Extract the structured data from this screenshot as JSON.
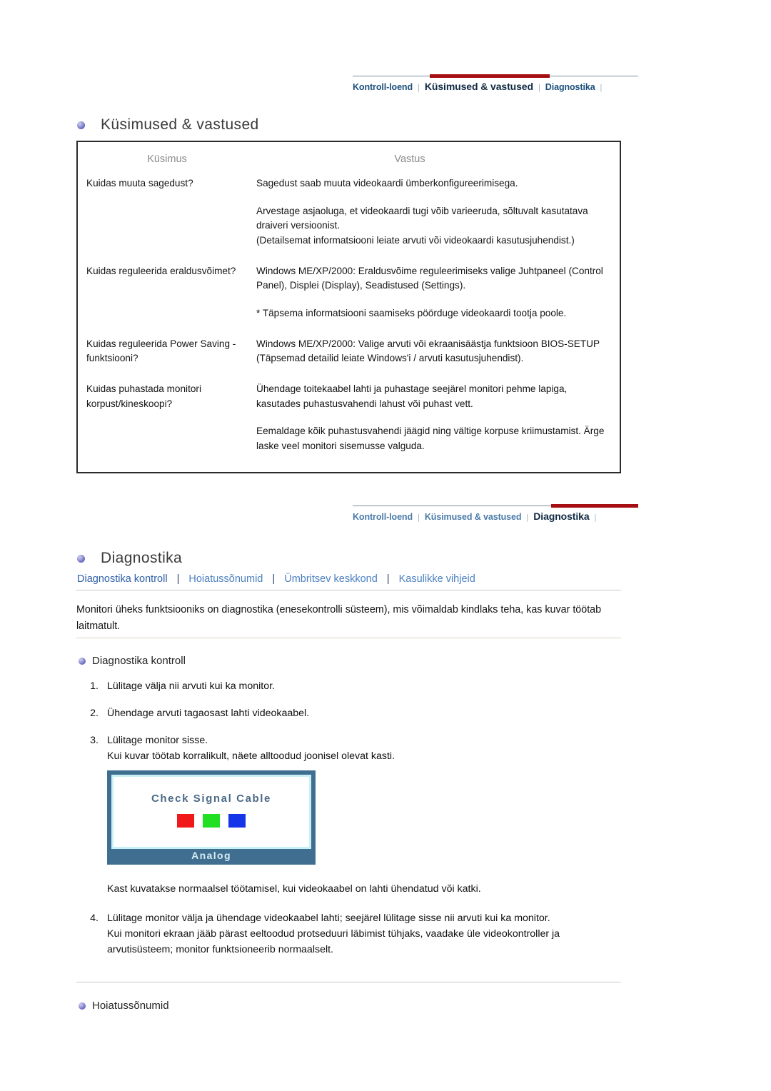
{
  "nav_top": {
    "items": [
      {
        "label": "Kontroll-loend",
        "active": false
      },
      {
        "label": "Küsimused & vastused",
        "active": true
      },
      {
        "label": "Diagnostika",
        "active": false
      }
    ],
    "separator": "|"
  },
  "nav_bottom": {
    "items": [
      {
        "label": "Kontroll-loend",
        "active": false
      },
      {
        "label": "Küsimused & vastused",
        "active": false
      },
      {
        "label": "Diagnostika",
        "active": true
      }
    ],
    "separator": "|"
  },
  "faq": {
    "heading": "Küsimused & vastused",
    "col_question": "Küsimus",
    "col_answer": "Vastus",
    "rows": [
      {
        "question": "Kuidas muuta sagedust?",
        "answer": [
          "Sagedust saab muuta videokaardi ümberkonfigureerimisega.",
          "Arvestage asjaoluga, et videokaardi tugi võib varieeruda, sõltuvalt kasutatava draiveri versioonist.\n(Detailsemat informatsiooni leiate arvuti või videokaardi kasutusjuhendist.)"
        ]
      },
      {
        "question": "Kuidas reguleerida eraldusvõimet?",
        "answer": [
          "Windows ME/XP/2000: Eraldusvõime reguleerimiseks valige Juhtpaneel (Control Panel), Displei (Display), Seadistused (Settings).",
          "* Täpsema informatsiooni saamiseks pöörduge videokaardi tootja poole."
        ]
      },
      {
        "question": "Kuidas reguleerida Power Saving -funktsiooni?",
        "answer": [
          "Windows ME/XP/2000: Valige arvuti või ekraanisäästja funktsioon BIOS-SETUP (Täpsemad detailid leiate Windows'i / arvuti kasutusjuhendist)."
        ]
      },
      {
        "question": "Kuidas puhastada monitori korpust/kineskoopi?",
        "answer": [
          "Ühendage toitekaabel lahti ja puhastage seejärel monitori pehme lapiga, kasutades puhastusvahendi lahust või puhast vett.",
          "Eemaldage kõik puhastusvahendi jäägid ning vältige korpuse kriimustamist. Ärge laske veel monitori sisemusse valguda."
        ]
      }
    ]
  },
  "diagnostics": {
    "heading": "Diagnostika",
    "sublinks": [
      "Diagnostika kontroll",
      "Hoiatussõnumid",
      "Ümbritsev keskkond",
      "Kasulikke vihjeid"
    ],
    "sublink_separator": "|",
    "intro": "Monitori üheks funktsiooniks on diagnostika (enesekontrolli süsteem), mis võimaldab kindlaks teha, kas kuvar töötab laitmatult.",
    "subhead_check": "Diagnostika kontroll",
    "steps": [
      {
        "num": "1.",
        "lines": [
          "Lülitage välja nii arvuti kui ka monitor."
        ]
      },
      {
        "num": "2.",
        "lines": [
          "Ühendage arvuti tagaosast lahti videokaabel."
        ]
      },
      {
        "num": "3.",
        "lines": [
          "Lülitage monitor sisse.",
          "Kui kuvar töötab korralikult, näete alltoodud joonisel olevat kasti."
        ]
      }
    ],
    "osd": {
      "title": "Check Signal Cable",
      "footer": "Analog",
      "swatches": [
        "#f01818",
        "#21e024",
        "#1536e8"
      ],
      "frame_color": "#3f6e91",
      "glow_color": "#c7f1f4"
    },
    "osd_caption": "Kast kuvatakse normaalsel töötamisel, kui videokaabel on lahti ühendatud või katki.",
    "step4": {
      "num": "4.",
      "lines": [
        "Lülitage monitor välja ja ühendage videokaabel lahti; seejärel lülitage sisse nii arvuti kui ka monitor.",
        "Kui monitori ekraan jääb pärast eeltoodud protseduuri läbimist tühjaks, vaadake üle videokontroller ja arvutisüsteem; monitor funktsioneerib normaalselt."
      ]
    },
    "subhead_warnings": "Hoiatussõnumid"
  }
}
